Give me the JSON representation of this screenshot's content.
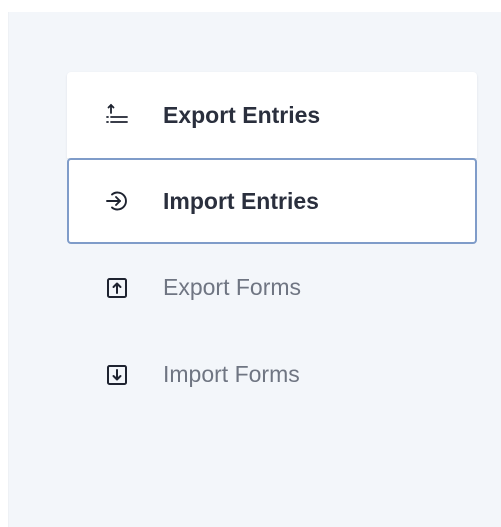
{
  "menu": {
    "items": [
      {
        "id": "export-entries",
        "label": "Export Entries",
        "icon": "export-list-icon",
        "state": "hover"
      },
      {
        "id": "import-entries",
        "label": "Import Entries",
        "icon": "import-arrow-circle-icon",
        "state": "selected"
      },
      {
        "id": "export-forms",
        "label": "Export Forms",
        "icon": "upload-box-icon",
        "state": "normal"
      },
      {
        "id": "import-forms",
        "label": "Import Forms",
        "icon": "download-box-icon",
        "state": "normal"
      }
    ]
  },
  "colors": {
    "panel_background": "#f3f6fa",
    "active_text": "#2a2f3d",
    "inactive_text": "#6f7582",
    "selected_border": "#7f9cc9"
  }
}
